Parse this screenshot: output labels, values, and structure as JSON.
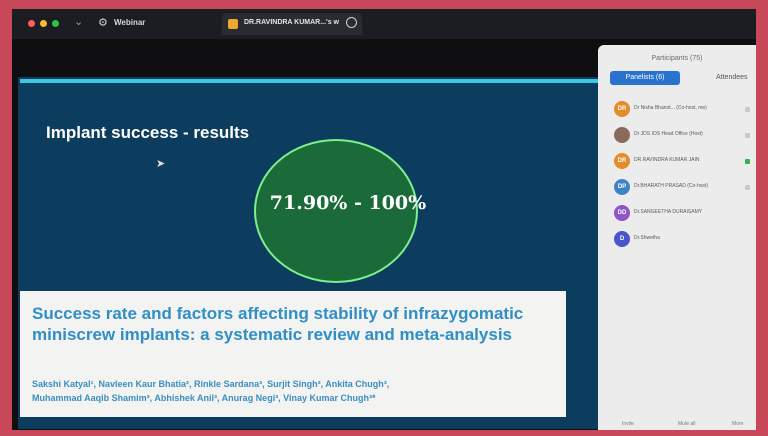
{
  "window": {
    "app_label": "Webinar",
    "tab_label": "DR.RAVINDRA KUMAR...'s w"
  },
  "slide": {
    "title": "Implant success  - results",
    "highlight": "71.90% - 100%",
    "paper_title": "Success rate and factors affecting stability of infrazygomatic miniscrew implants: a systematic review and meta-analysis",
    "authors_line1": "Sakshi Katyal¹, Navleen Kaur Bhatia², Rinkle Sardana³, Surjit Singh³, Ankita Chugh³,",
    "authors_line2": "Muhammad Aaqib Shamim³, Abhishek Anil³, Anurag Negi³, Vinay Kumar Chugh³*"
  },
  "participants": {
    "title": "Participants (75)",
    "tabs": [
      "Panelists (6)",
      "Attendees"
    ],
    "list": [
      {
        "initials": "DR",
        "name": "Dr Nisha Bhanot... (Co-host, me)",
        "color": "#e48b2a"
      },
      {
        "initials": "",
        "name": "Dr JDS IOS Head Office (Host)",
        "color": "#8a6a5a"
      },
      {
        "initials": "DR",
        "name": "DR.RAVINDRA KUMAR JAIN",
        "color": "#e48b2a"
      },
      {
        "initials": "DP",
        "name": "Dr.BHARATH PRASAD (Co-host)",
        "color": "#3d85c6"
      },
      {
        "initials": "DD",
        "name": "Dr.SANGEETHA DURAISAMY",
        "color": "#8e55c8"
      },
      {
        "initials": "D",
        "name": "Dr.Shwetha",
        "color": "#4a55c8"
      }
    ],
    "bottom": [
      "Invite",
      "Mute all",
      "More"
    ]
  }
}
